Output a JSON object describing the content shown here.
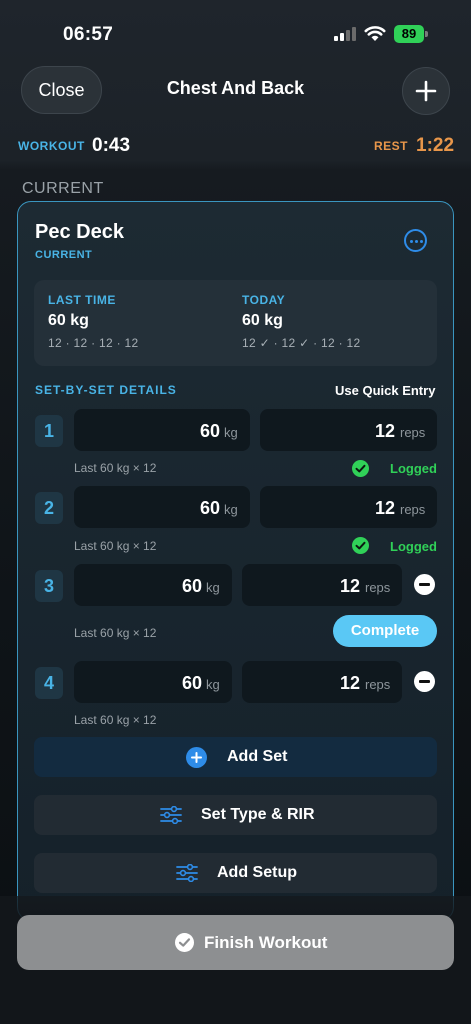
{
  "status_bar": {
    "time": "06:57",
    "battery": "89"
  },
  "nav": {
    "close_label": "Close",
    "title": "Chest And Back",
    "add_icon": "plus-icon"
  },
  "timers": {
    "workout_label": "WORKOUT",
    "workout_time": "0:43",
    "rest_label": "REST",
    "rest_time": "1:22"
  },
  "section_label": "CURRENT",
  "exercise": {
    "name": "Pec Deck",
    "status": "CURRENT",
    "more_icon": "ellipsis-circle-icon",
    "last_time": {
      "label": "LAST TIME",
      "weight": "60 kg",
      "sets": "12 · 12 · 12 · 12"
    },
    "today": {
      "label": "TODAY",
      "weight": "60 kg",
      "sets": "12 ✓ · 12 ✓ · 12 · 12"
    },
    "details_label": "SET-BY-SET DETAILS",
    "quick_entry_label": "Use Quick Entry",
    "sets": [
      {
        "num": "1",
        "weight": "60",
        "weight_unit": "kg",
        "reps": "12",
        "reps_unit": "reps",
        "last": "Last 60 kg × 12",
        "status": "Logged"
      },
      {
        "num": "2",
        "weight": "60",
        "weight_unit": "kg",
        "reps": "12",
        "reps_unit": "reps",
        "last": "Last 60 kg × 12",
        "status": "Logged"
      },
      {
        "num": "3",
        "weight": "60",
        "weight_unit": "kg",
        "reps": "12",
        "reps_unit": "reps",
        "last": "Last 60 kg × 12",
        "action": "Complete"
      },
      {
        "num": "4",
        "weight": "60",
        "weight_unit": "kg",
        "reps": "12",
        "reps_unit": "reps",
        "last": "Last 60 kg × 12"
      }
    ],
    "add_set_label": "Add Set",
    "set_type_label": "Set Type & RIR",
    "add_setup_label": "Add Setup"
  },
  "finish_label": "Finish Workout",
  "colors": {
    "accent": "#49b4e6",
    "rest": "#e8964a",
    "success": "#30d158",
    "complete": "#5ac8f5",
    "primary_blue": "#2e8ce8"
  }
}
